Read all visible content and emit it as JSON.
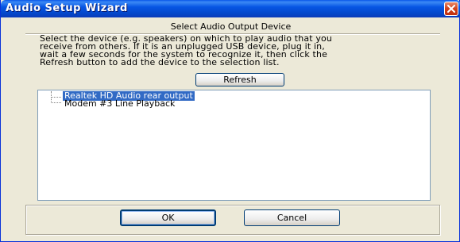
{
  "window": {
    "title": "Audio Setup Wizard",
    "accent_color": "#0655e3",
    "close_icon": "close-icon"
  },
  "header": {
    "subtitle": "Select Audio Output Device"
  },
  "instructions": {
    "text": "Select the device (e.g. speakers) on which to play audio that you\nreceive from others.  If it is an unplugged USB device, plug it in,\nwait a few seconds for the system to recognize it, then click the\nRefresh button to add the device to the selection list."
  },
  "toolbar": {
    "refresh_label": "Refresh"
  },
  "device_list": {
    "items": [
      {
        "label": "Realtek HD Audio rear output",
        "selected": true
      },
      {
        "label": "Modem #3 Line Playback",
        "selected": false
      }
    ],
    "selection_color": "#316ac5"
  },
  "footer": {
    "ok_label": "OK",
    "cancel_label": "Cancel"
  }
}
